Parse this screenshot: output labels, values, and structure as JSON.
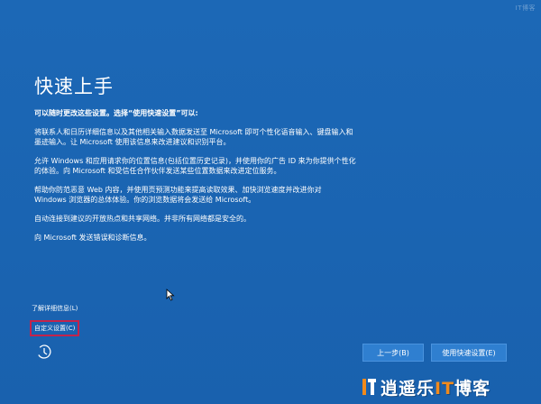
{
  "header": {
    "title": "快速上手",
    "watermark": "IT博客"
  },
  "content": {
    "subheading": "可以随时更改这些设置。选择“使用快速设置”可以:",
    "paragraphs": [
      "将联系人和日历详细信息以及其他相关输入数据发送至 Microsoft 即可个性化语音输入、键盘输入和\n墨迹输入。让 Microsoft 使用该信息来改进建议和识别平台。",
      "允许 Windows 和应用请求你的位置信息(包括位置历史记录)，并使用你的广告 ID 来为你提供个性化\n的体验。向 Microsoft 和受信任合作伙伴发送某些位置数据来改进定位服务。",
      "帮助你防范恶意 Web 内容，并使用页预测功能来提高读取效果、加快浏览速度并改进你对\nWindows 浏览器的总体体验。你的浏览数据将会发送给 Microsoft。",
      "自动连接到建议的开放热点和共享网络。并非所有网络都是安全的。",
      "向 Microsoft 发送错误和诊断信息。"
    ]
  },
  "links": {
    "learn_more": "了解详细信息(L)",
    "customize": "自定义设置(C)"
  },
  "buttons": {
    "back": "上一步(B)",
    "express": "使用快速设置(E)"
  },
  "brand": {
    "name_part1": "逍遥乐",
    "name_it": "IT",
    "name_part2": "博客"
  },
  "colors": {
    "background": "#1a65b3",
    "button": "#2f7fd0",
    "highlight_border": "#c4234b",
    "brand_accent": "#f08a1c"
  },
  "icons": {
    "accessibility": "ease-of-access-icon",
    "cursor": "mouse-pointer-icon",
    "brand_logo": "brand-logo-icon"
  }
}
